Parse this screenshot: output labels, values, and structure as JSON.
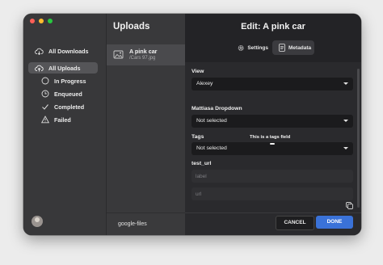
{
  "sidebar": {
    "items": [
      {
        "label": "All Downloads",
        "icon": "cloud-download-icon"
      },
      {
        "label": "All Uploads",
        "icon": "cloud-upload-icon"
      },
      {
        "label": "In Progress",
        "icon": "progress-circle-icon"
      },
      {
        "label": "Enqueued",
        "icon": "clock-icon"
      },
      {
        "label": "Completed",
        "icon": "checkmark-icon"
      },
      {
        "label": "Failed",
        "icon": "warning-icon"
      }
    ]
  },
  "uploads": {
    "title": "Uploads",
    "items": [
      {
        "title": "A pink car",
        "file": "/Cars 97.jpg"
      }
    ],
    "footer_label": "google-files"
  },
  "edit": {
    "title": "Edit: A pink car",
    "tabs": [
      {
        "label": "Settings",
        "icon": "gear-icon"
      },
      {
        "label": "Metadata",
        "icon": "document-icon"
      }
    ],
    "fields": {
      "view": {
        "label": "View",
        "value": "Alexey"
      },
      "dropdown": {
        "label": "Mattiasa Dropdown",
        "value": "Not selected",
        "tooltip": "This is a tags field"
      },
      "tags": {
        "label": "Tags",
        "value": "Not selected"
      },
      "test_url": {
        "label": "test_url",
        "label_placeholder": "label",
        "url_placeholder": "url"
      }
    },
    "cancel_label": "CANCEL",
    "done_label": "DONE"
  },
  "colors": {
    "accent": "#3a72d8",
    "sidebar_bg": "#38383a",
    "panel_bg": "#232326"
  }
}
